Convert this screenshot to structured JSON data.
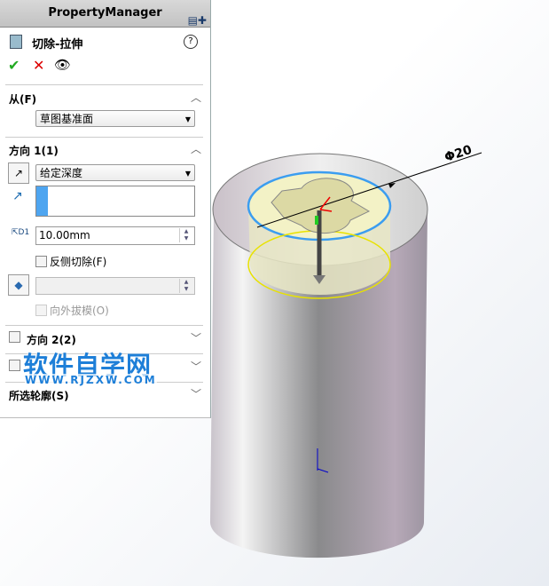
{
  "panel": {
    "title": "PropertyManager",
    "feature_title": "切除-拉伸",
    "help": "?",
    "from": {
      "label": "从(F)",
      "value": "草图基准面"
    },
    "dir1": {
      "label": "方向 1(1)",
      "end_condition": "给定深度",
      "depth": "10.00mm",
      "depth_icon_label": "D1",
      "flip_side": "反侧切除(F)",
      "draft_outward": "向外拔模(O)"
    },
    "dir2": {
      "label": "方向 2(2)"
    },
    "thin": {
      "label": ""
    },
    "contours": {
      "label": "所选轮廓(S)"
    }
  },
  "watermark": {
    "text": "软件自学网",
    "url": "WWW.RJZXW.COM"
  },
  "viewport": {
    "dimension": "Φ20"
  }
}
